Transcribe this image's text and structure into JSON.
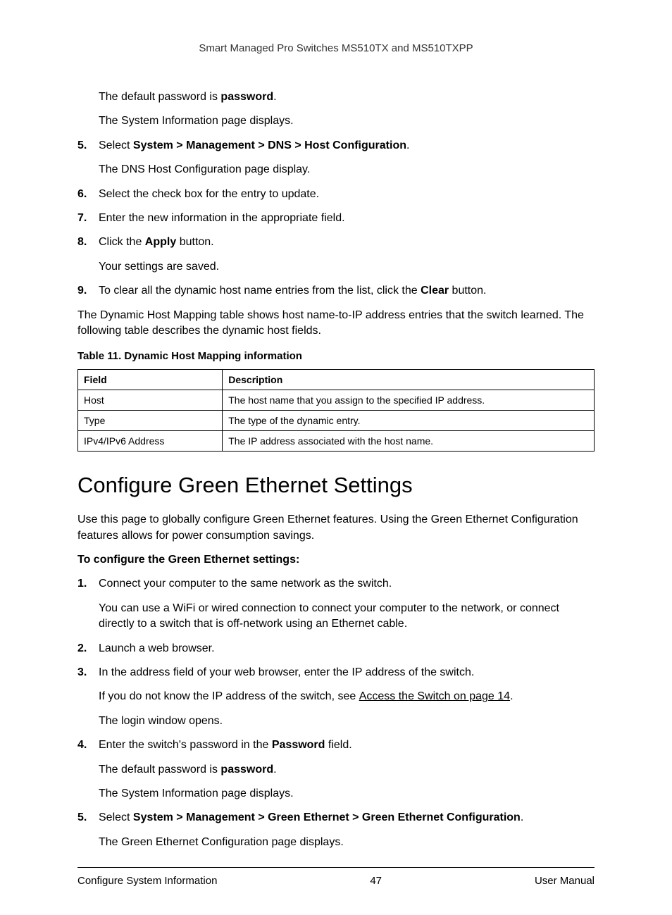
{
  "header": "Smart Managed Pro Switches MS510TX and MS510TXPP",
  "intro": {
    "p1_pre": "The default password is ",
    "p1_bold": "password",
    "p1_post": ".",
    "p2": "The System Information page displays."
  },
  "steps1": {
    "s5": {
      "num": "5.",
      "pre": "Select ",
      "bold": "System > Management > DNS > Host Configuration",
      "post": ".",
      "sub": "The DNS Host Configuration page display."
    },
    "s6": {
      "num": "6.",
      "text": "Select the check box for the entry to update."
    },
    "s7": {
      "num": "7.",
      "text": "Enter the new information in the appropriate field."
    },
    "s8": {
      "num": "8.",
      "pre": "Click the ",
      "bold": "Apply",
      "post": " button.",
      "sub": "Your settings are saved."
    },
    "s9": {
      "num": "9.",
      "pre": "To clear all the dynamic host name entries from the list, click the ",
      "bold": "Clear",
      "post": " button."
    }
  },
  "afterSteps": "The Dynamic Host Mapping table shows host name-to-IP address entries that the switch learned. The following table describes the dynamic host fields.",
  "tableCaption": "Table 11.  Dynamic Host Mapping information",
  "table": {
    "h1": "Field",
    "h2": "Description",
    "rows": [
      {
        "f": "Host",
        "d": "The host name that you assign to the specified IP address."
      },
      {
        "f": "Type",
        "d": "The type of the dynamic entry."
      },
      {
        "f": "IPv4/IPv6 Address",
        "d": "The IP address associated with the host name."
      }
    ]
  },
  "section2": {
    "title": "Configure Green Ethernet Settings",
    "intro": "Use this page to globally configure Green Ethernet features. Using the Green Ethernet Configuration features allows for power consumption savings.",
    "lead": "To configure the Green Ethernet settings:",
    "s1": {
      "num": "1.",
      "text": "Connect your computer to the same network as the switch.",
      "sub": "You can use a WiFi or wired connection to connect your computer to the network, or connect directly to a switch that is off-network using an Ethernet cable."
    },
    "s2": {
      "num": "2.",
      "text": "Launch a web browser."
    },
    "s3": {
      "num": "3.",
      "text": "In the address field of your web browser, enter the IP address of the switch.",
      "sub_pre": "If you do not know the IP address of the switch, see ",
      "sub_link": "Access the Switch on page 14",
      "sub_post": ".",
      "sub2": "The login window opens."
    },
    "s4": {
      "num": "4.",
      "pre": "Enter the switch's password in the ",
      "bold": "Password",
      "post": " field.",
      "sub_pre": "The default password is ",
      "sub_bold": "password",
      "sub_post": ".",
      "sub2": "The System Information page displays."
    },
    "s5": {
      "num": "5.",
      "pre": "Select ",
      "bold": "System > Management > Green Ethernet > Green Ethernet Configuration",
      "post": ".",
      "sub": "The Green Ethernet Configuration page displays."
    }
  },
  "footer": {
    "left": "Configure System Information",
    "center": "47",
    "right": "User Manual"
  }
}
